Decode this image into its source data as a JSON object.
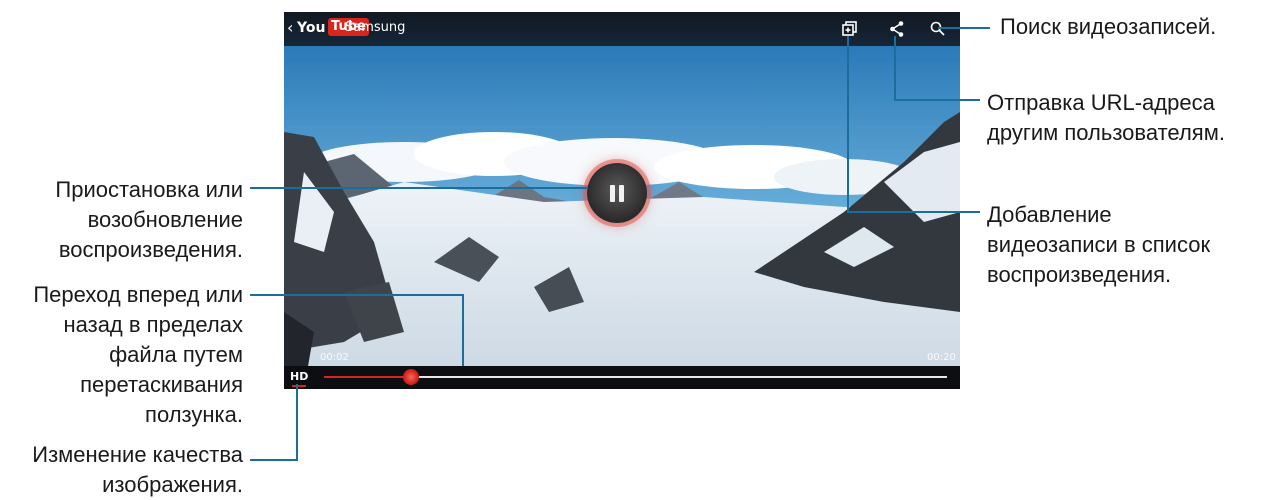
{
  "video": {
    "back_glyph": "‹",
    "logo_you": "You",
    "logo_tube": "Tube",
    "channel": "Samsung",
    "time_elapsed": "00:02",
    "time_total": "00:20",
    "quality_label": "HD",
    "progress": 0.14
  },
  "icons": {
    "playlist": "add-to-playlist-icon",
    "share": "share-icon",
    "search": "search-icon",
    "pause": "pause-icon"
  },
  "callouts": {
    "search": "Поиск видеозаписей.",
    "share": [
      "Отправка URL-адреса",
      "другим пользователям."
    ],
    "playlist": [
      "Добавление",
      "видеозаписи в список",
      "воспроизведения."
    ],
    "pause": [
      "Приостановка или",
      "возобновление",
      "воспроизведения."
    ],
    "seek": [
      "Переход вперед или",
      "назад в пределах",
      "файла путем",
      "перетаскивания",
      "ползунка."
    ],
    "quality": [
      "Изменение качества",
      "изображения."
    ]
  },
  "colors": {
    "accent_red": "#d8261d",
    "leader_line": "#1b6e9c"
  }
}
